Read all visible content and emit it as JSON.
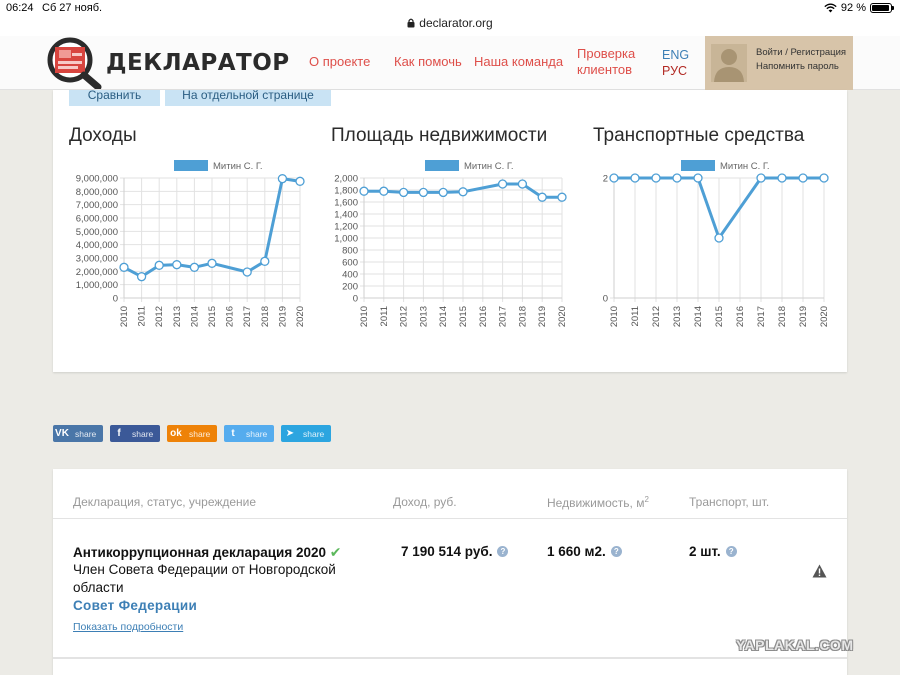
{
  "status": {
    "time": "06:24",
    "date": "Сб 27 нояб.",
    "battery": "92 %"
  },
  "browser": {
    "url": "declarator.org"
  },
  "header": {
    "logo_text": "ДЕКЛАРАТОР",
    "nav": [
      "О проекте",
      "Как помочь",
      "Наша команда",
      "Проверка\nклиентов"
    ],
    "lang_en": "ENG",
    "lang_ru": "РУС",
    "login_link": "Войти / Регистрация",
    "remind_link": "Напомнить пароль"
  },
  "tabs": {
    "compare": "Сравнить",
    "separate_page": "На отдельной странице"
  },
  "colors": {
    "series": "#4e9fd5",
    "nav": "#de4f4a",
    "link": "#3d7fb5"
  },
  "chart_data": [
    {
      "type": "line",
      "title": "Доходы",
      "x": [
        "2010",
        "2011",
        "2012",
        "2013",
        "2014",
        "2015",
        "2016",
        "2017",
        "2018",
        "2019",
        "2020"
      ],
      "series": [
        {
          "name": "Митин С. Г.",
          "values": [
            2300000,
            1600000,
            2450000,
            2500000,
            2300000,
            2600000,
            null,
            1950000,
            2750000,
            8950000,
            8750000
          ]
        }
      ],
      "yticks": [
        "9,000,000",
        "8,000,000",
        "7,000,000",
        "6,000,000",
        "5,000,000",
        "4,000,000",
        "3,000,000",
        "2,000,000",
        "1,000,000",
        "0"
      ],
      "ylim": [
        0,
        9000000
      ]
    },
    {
      "type": "line",
      "title": "Площадь недвижимости",
      "x": [
        "2010",
        "2011",
        "2012",
        "2013",
        "2014",
        "2015",
        "2016",
        "2017",
        "2018",
        "2019",
        "2020"
      ],
      "series": [
        {
          "name": "Митин С. Г.",
          "values": [
            1780,
            1780,
            1760,
            1760,
            1760,
            1770,
            null,
            1900,
            1900,
            1680,
            1680
          ]
        }
      ],
      "yticks": [
        "2,000",
        "1,800",
        "1,600",
        "1,400",
        "1,200",
        "1,000",
        "800",
        "600",
        "400",
        "200",
        "0"
      ],
      "ylim": [
        0,
        2000
      ]
    },
    {
      "type": "line",
      "title": "Транспортные средства",
      "x": [
        "2010",
        "2011",
        "2012",
        "2013",
        "2014",
        "2015",
        "2016",
        "2017",
        "2018",
        "2019",
        "2020"
      ],
      "series": [
        {
          "name": "Митин С. Г.",
          "values": [
            2,
            2,
            2,
            2,
            2,
            1,
            null,
            2,
            2,
            2,
            2
          ]
        }
      ],
      "yticks": [
        "2",
        "0"
      ],
      "ylim": [
        0,
        2
      ]
    }
  ],
  "share": [
    {
      "icon": "vk-icon",
      "glyph": "VK",
      "label": "share",
      "color": "#4a76a8"
    },
    {
      "icon": "facebook-icon",
      "glyph": "f",
      "label": "share",
      "color": "#3b5998"
    },
    {
      "icon": "odnoklassniki-icon",
      "glyph": "ok",
      "label": "share",
      "color": "#ee8208"
    },
    {
      "icon": "twitter-icon",
      "glyph": "t",
      "label": "share",
      "color": "#55acee"
    },
    {
      "icon": "telegram-icon",
      "glyph": "➤",
      "label": "share",
      "color": "#2ca5e0"
    }
  ],
  "table": {
    "headers": {
      "declaration": "Декларация, статус, учреждение",
      "income": "Доход, руб.",
      "realty": "Недвижимость, м",
      "realty_sup": "2",
      "transport": "Транспорт, шт."
    },
    "row": {
      "title": "Антикоррупционная декларация 2020",
      "position_line1": "Член Совета Федерации от Новгородской",
      "position_line2": "области",
      "org": "Совет Федерации",
      "details_link": "Показать подробности",
      "income": "7 190 514 руб.",
      "realty": "1 660 м2.",
      "transport": "2 шт."
    }
  },
  "watermark": "YAPLAKAL.COM"
}
